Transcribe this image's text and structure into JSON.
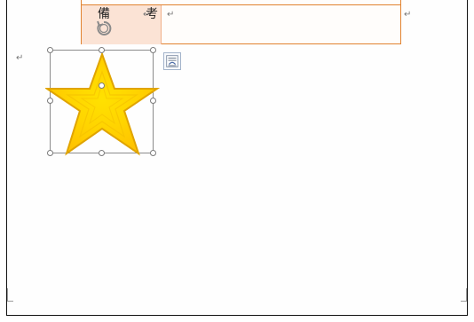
{
  "document": {
    "table": {
      "cell_label": "備　考",
      "paragraph_mark": "↵"
    },
    "paragraph_marks": {
      "left": "↵",
      "right": "↵"
    }
  },
  "selection": {
    "layout_button": "layout-options-icon",
    "rotate_handle": "rotate-icon"
  },
  "shape": {
    "type": "star",
    "fill": "#FFD400",
    "stroke": "#E0A400"
  },
  "colors": {
    "table_border": "#E1822F",
    "table_fill": "#FBE3D5",
    "selection_border": "#8C8C8C"
  }
}
